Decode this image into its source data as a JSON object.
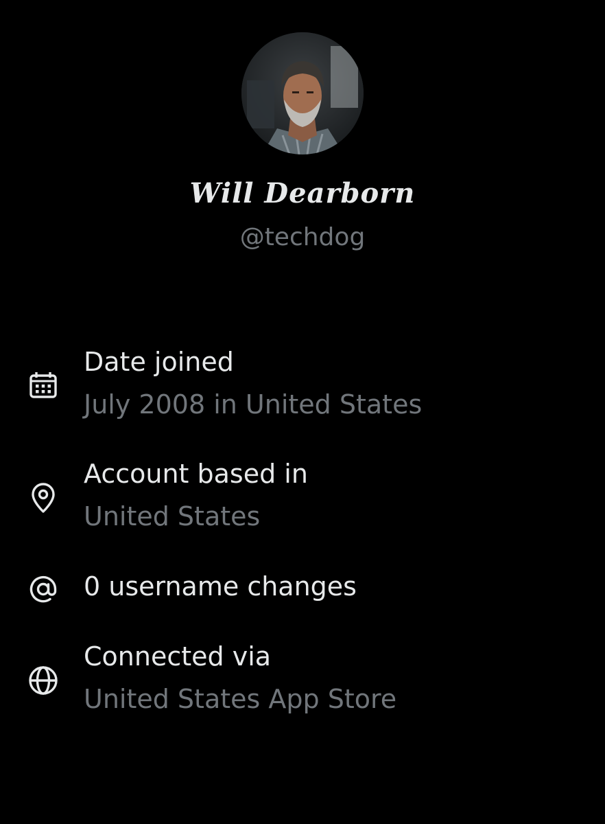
{
  "profile": {
    "display_name": "Will Dearborn",
    "handle": "@techdog"
  },
  "details": [
    {
      "icon": "calendar-icon",
      "label": "Date joined",
      "value": "July 2008 in United States"
    },
    {
      "icon": "location-pin-icon",
      "label": "Account based in",
      "value": "United States"
    },
    {
      "icon": "at-sign-icon",
      "label": "0 username changes"
    },
    {
      "icon": "globe-icon",
      "label": "Connected via",
      "value": "United States App Store"
    }
  ],
  "colors": {
    "background": "#000000",
    "primary_text": "#e7e9ea",
    "secondary_text": "#71767b"
  }
}
